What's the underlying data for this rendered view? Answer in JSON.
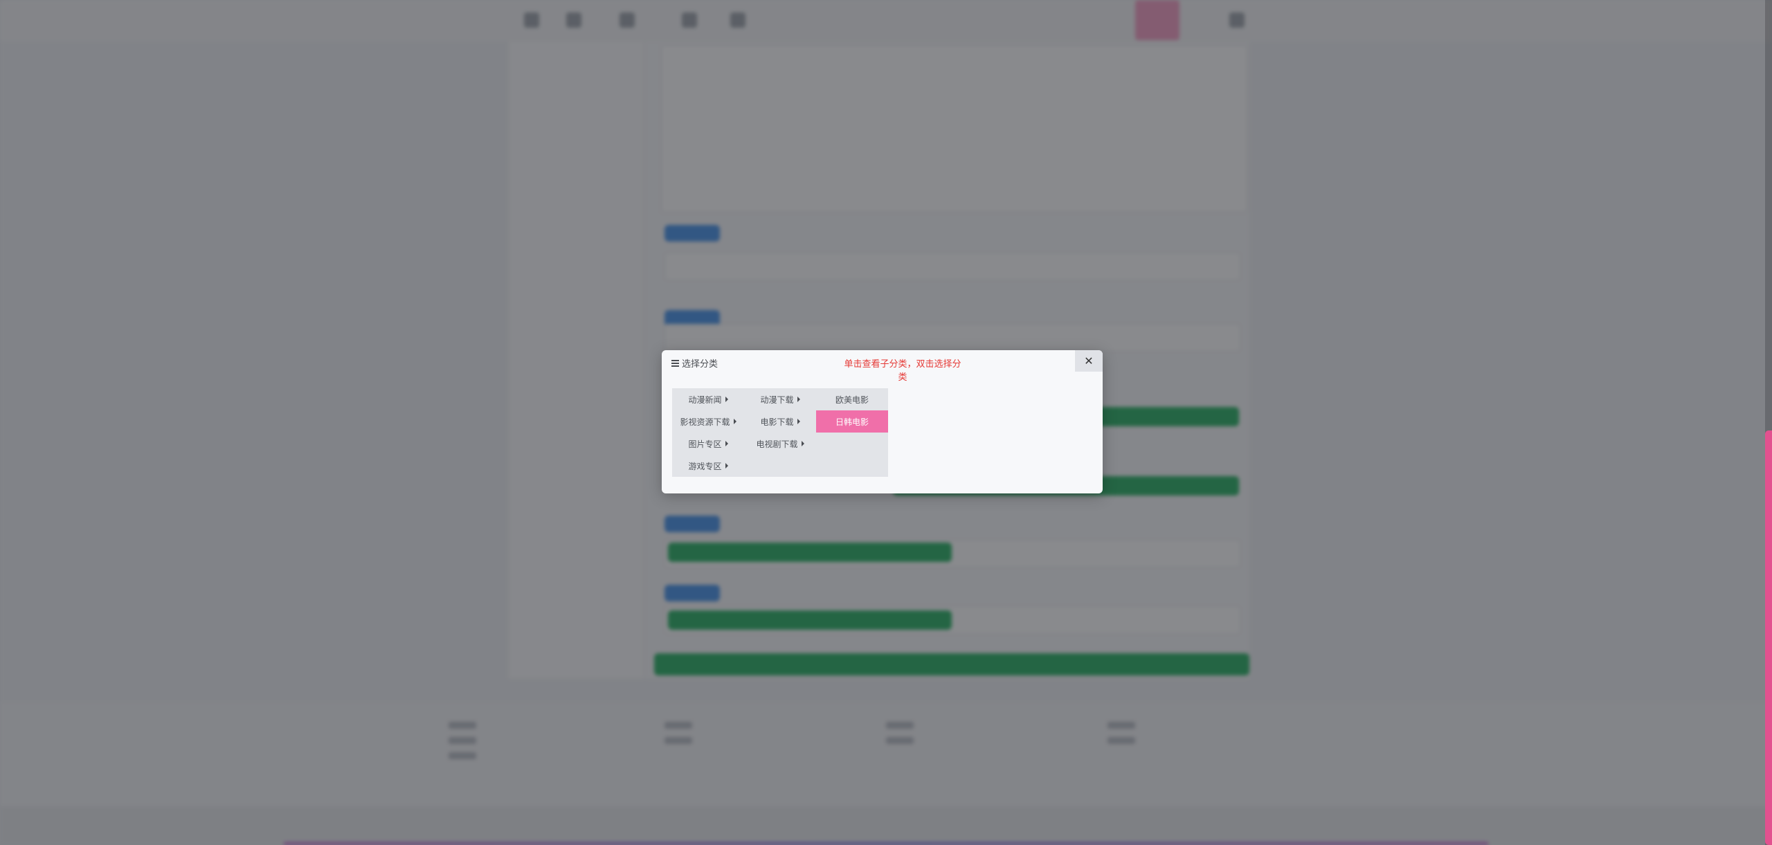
{
  "dialog": {
    "title": "选择分类",
    "hint": "单击查看子分类，双击选择分类",
    "close_label": "✕",
    "columns": [
      {
        "items": [
          {
            "label": "动漫新闻",
            "has_children": true
          },
          {
            "label": "影视资源下载",
            "has_children": true
          },
          {
            "label": "图片专区",
            "has_children": true
          },
          {
            "label": "游戏专区",
            "has_children": true
          }
        ]
      },
      {
        "items": [
          {
            "label": "动漫下载",
            "has_children": true
          },
          {
            "label": "电影下载",
            "has_children": true
          },
          {
            "label": "电视剧下载",
            "has_children": true
          }
        ]
      },
      {
        "items": [
          {
            "label": "欧美电影",
            "has_children": false
          },
          {
            "label": "日韩电影",
            "has_children": false,
            "selected": true
          }
        ]
      }
    ],
    "selected_color": "#f06fa9"
  },
  "colors": {
    "hint_text": "#e53935",
    "scrollbar_thumb": "#e2518f"
  }
}
